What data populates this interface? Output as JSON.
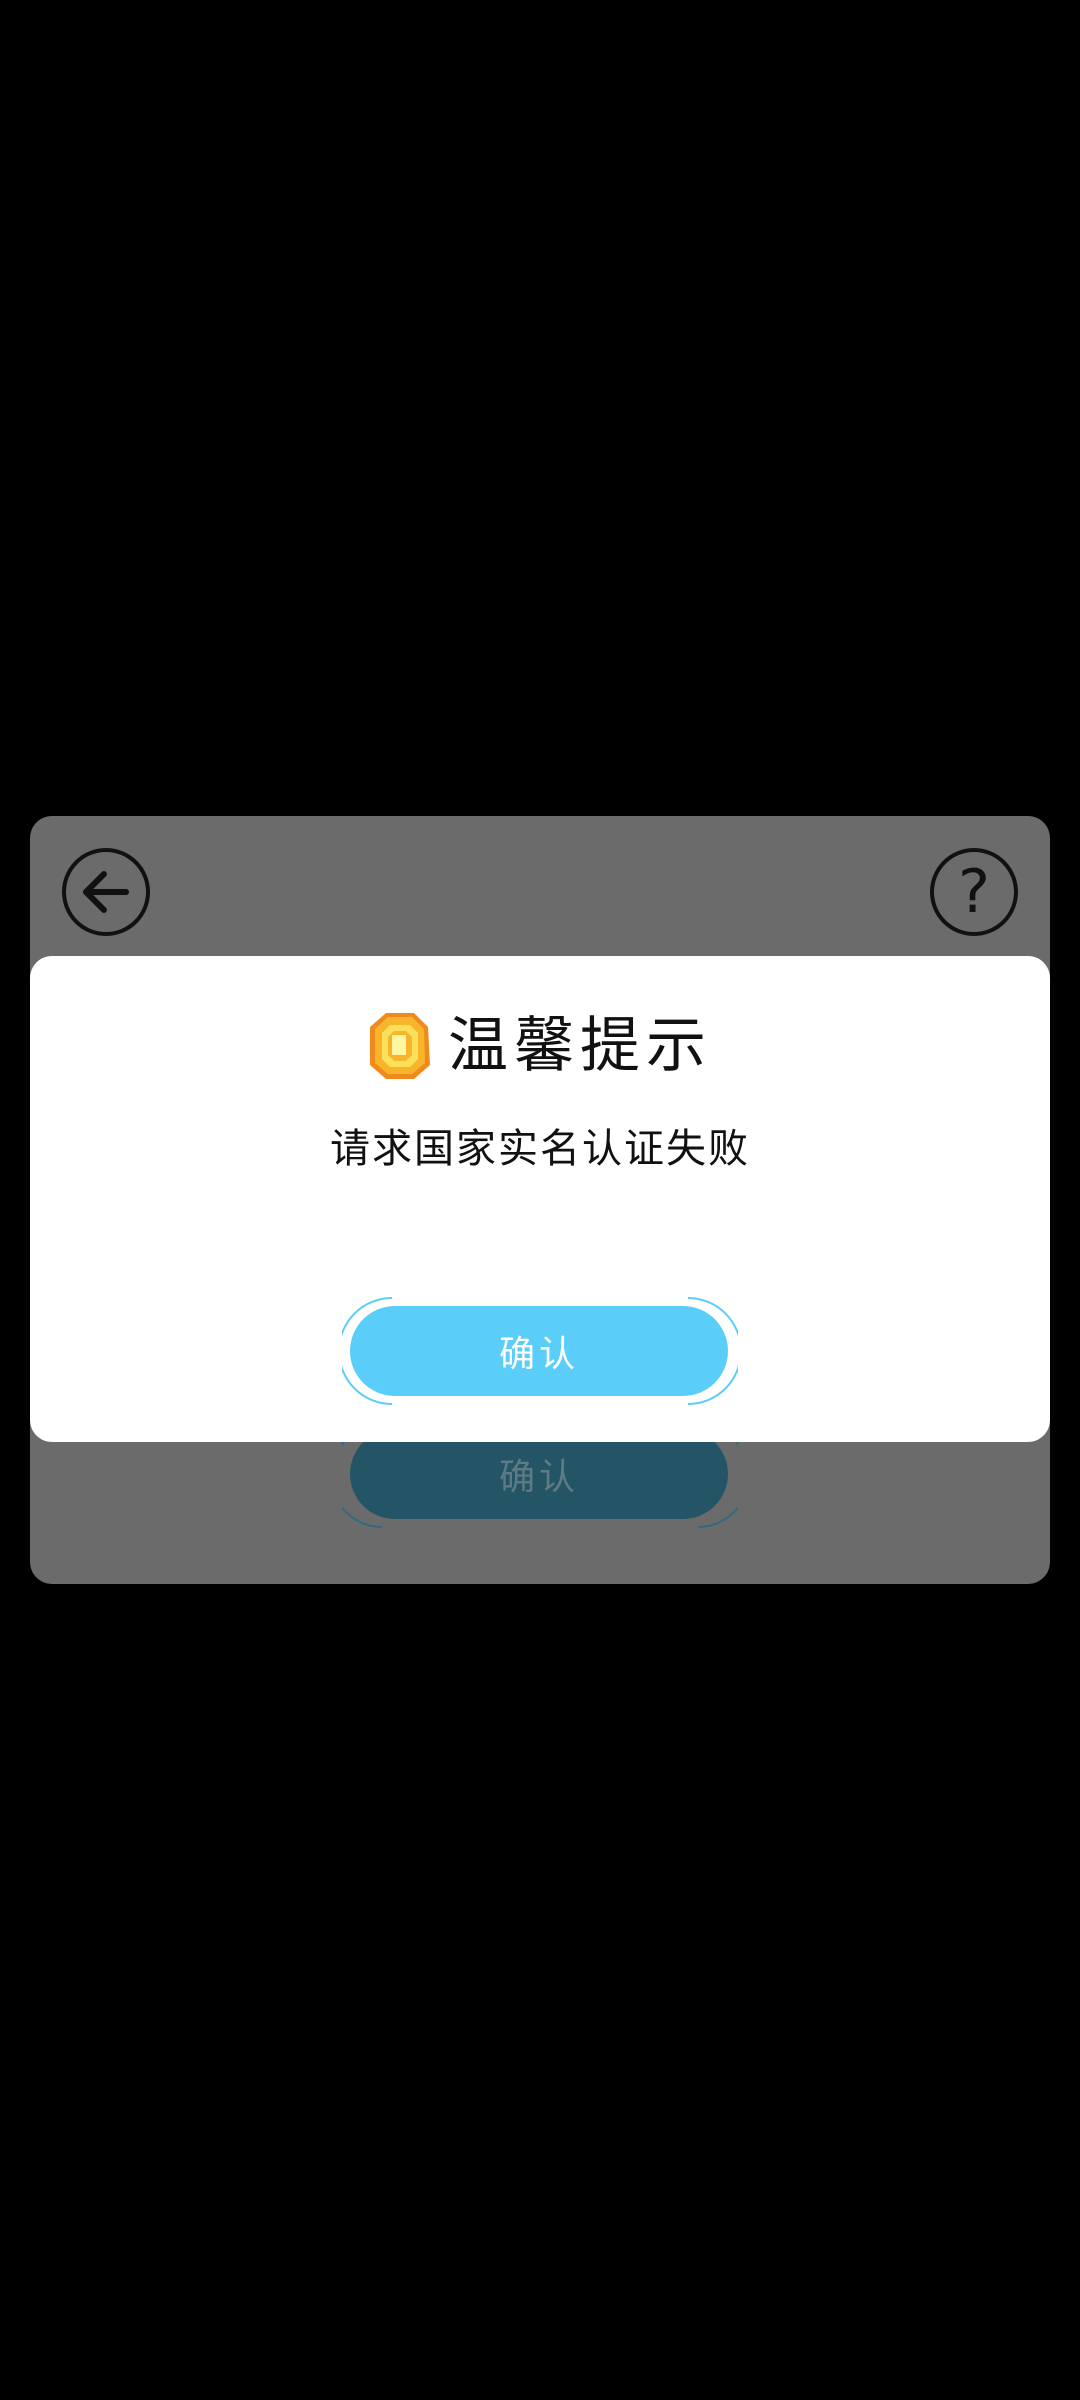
{
  "background_panel": {
    "back_icon": "arrow-left-icon",
    "help_icon": "question-mark-icon",
    "help_glyph": "?",
    "confirm_label": "确认"
  },
  "dialog": {
    "icon": "coin-icon",
    "title": "温馨提示",
    "message": "请求国家实名认证失败",
    "confirm_label": "确认"
  },
  "colors": {
    "backdrop": "#000000",
    "panel": "#6b6b6b",
    "dialog": "#ffffff",
    "accent": "#5bcdf9",
    "coin": "#f7b52c"
  }
}
